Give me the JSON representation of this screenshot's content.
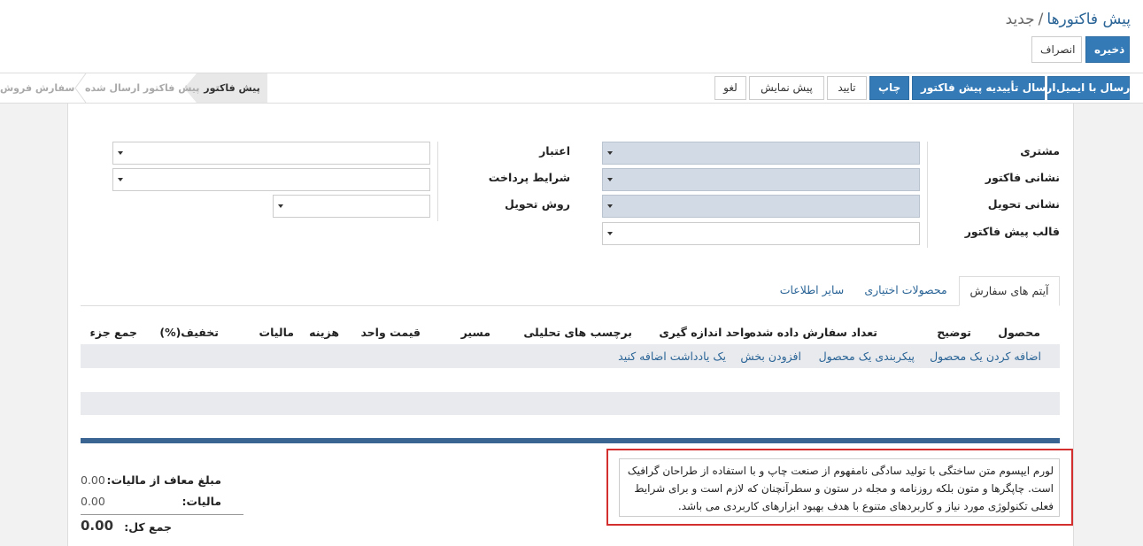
{
  "breadcrumb": {
    "parent": "پیش فاکتورها",
    "separator": "/",
    "current": "جدید"
  },
  "buttons": {
    "save": "ذخیره",
    "discard": "انصراف"
  },
  "actions": {
    "send_email": "ارسال با ایمیل",
    "send_proforma": "ارسال تأییدیه پیش فاکتور",
    "print": "چاپ",
    "confirm": "تایید",
    "preview": "پیش نمایش",
    "cancel": "لغو"
  },
  "stages": [
    "پیش فاکتور",
    "پیش فاکتور ارسال شده",
    "سفارش فروش"
  ],
  "form": {
    "customer": "مشتری",
    "invoice_address": "نشانی فاکتور",
    "delivery_address": "نشانی تحویل",
    "quotation_template": "قالب پیش فاکتور",
    "validity": "اعتبار",
    "payment_terms": "شرایط پرداخت",
    "delivery_method": "روش تحویل"
  },
  "tabs": [
    "آیتم های سفارش",
    "محصولات اختیاری",
    "سایر اطلاعات"
  ],
  "columns": [
    "محصول",
    "توضیح",
    "تعداد سفارش داده شده",
    "واحد اندازه گیری",
    "برچسب های تحلیلی",
    "مسیر",
    "قیمت واحد",
    "هزینه",
    "مالیات",
    "تخفیف(%)",
    "جمع جزء"
  ],
  "add_links": [
    "اضافه کردن یک محصول",
    "پیکربندی یک محصول",
    "افزودن بخش",
    "یک یادداشت اضافه کنید"
  ],
  "note": "لورم ایپسوم متن ساختگی با تولید سادگی نامفهوم از صنعت چاپ و با استفاده از طراحان گرافیک است. چاپگرها و متون بلکه روزنامه و مجله در ستون و سطرآنچنان که لازم است و برای شرایط فعلی تکنولوژی مورد نیاز و کاربردهای متنوع با هدف بهبود ابزارهای کاربردی می باشد.",
  "totals": {
    "untaxed_label": "مبلغ معاف از مالیات:",
    "untaxed_value": "0.00",
    "tax_label": "مالیات:",
    "tax_value": "0.00",
    "total_label": "جمع کل:",
    "total_value": "0.00"
  },
  "colors": {
    "primary": "#337ab7",
    "link": "#2a6496",
    "required": "#d2dae5",
    "highlight": "#d32f2f"
  }
}
